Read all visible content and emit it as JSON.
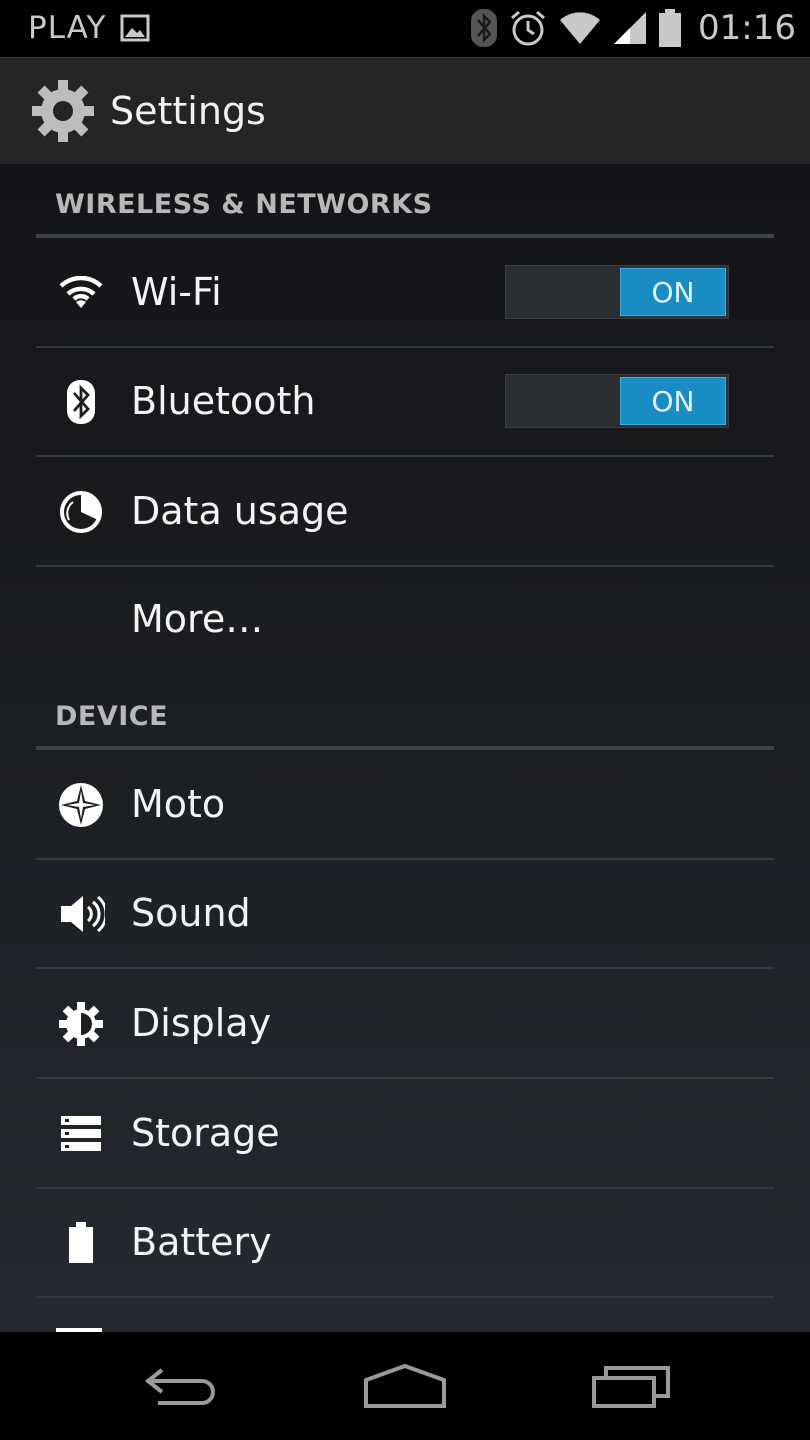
{
  "status_bar": {
    "carrier": "PLAY",
    "time": "01:16",
    "icons": [
      "image-icon",
      "bluetooth-icon",
      "alarm-icon",
      "wifi-icon",
      "signal-icon",
      "battery-icon"
    ]
  },
  "action_bar": {
    "title": "Settings",
    "icon": "settings-gear-icon"
  },
  "sections": [
    {
      "header": "WIRELESS & NETWORKS",
      "items": [
        {
          "label": "Wi-Fi",
          "icon": "wifi-icon",
          "toggle": "ON"
        },
        {
          "label": "Bluetooth",
          "icon": "bluetooth-icon",
          "toggle": "ON"
        },
        {
          "label": "Data usage",
          "icon": "data-usage-icon"
        },
        {
          "label": "More…"
        }
      ]
    },
    {
      "header": "DEVICE",
      "items": [
        {
          "label": "Moto",
          "icon": "moto-icon"
        },
        {
          "label": "Sound",
          "icon": "sound-icon"
        },
        {
          "label": "Display",
          "icon": "display-brightness-icon"
        },
        {
          "label": "Storage",
          "icon": "storage-icon"
        },
        {
          "label": "Battery",
          "icon": "battery-icon"
        }
      ]
    }
  ],
  "nav_bar": {
    "buttons": [
      "back-icon",
      "home-icon",
      "recents-icon"
    ]
  },
  "colors": {
    "accent": "#1a8cc4",
    "action_bar": "#242424",
    "header_text": "#b8b8b8"
  }
}
